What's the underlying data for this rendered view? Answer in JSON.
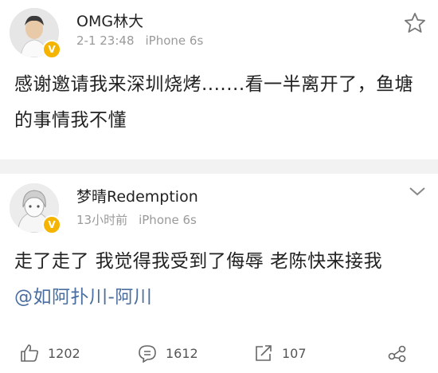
{
  "post1": {
    "username": "OMG林大",
    "date": "2-1 23:48",
    "device": "iPhone 6s",
    "text": "感谢邀请我来深圳烧烤.......看一半离开了，鱼塘的事情我不懂"
  },
  "post2": {
    "username": "梦晴Redemption",
    "time": "13小时前",
    "device": "iPhone 6s",
    "text_before": "走了走了 我觉得我受到了侮辱 老陈快来接我 ",
    "mention": "@如阿扑川-阿川"
  },
  "actions": {
    "likes": "1202",
    "comments": "1612",
    "reposts": "107"
  },
  "icons": [
    "star-icon",
    "chevron-down-icon",
    "like-icon",
    "comment-icon",
    "repost-icon",
    "share-icon",
    "verified-badge-icon"
  ],
  "colors": {
    "badge": "#f5b400",
    "mention": "#4a6ea0",
    "meta": "#9a9a9a"
  }
}
